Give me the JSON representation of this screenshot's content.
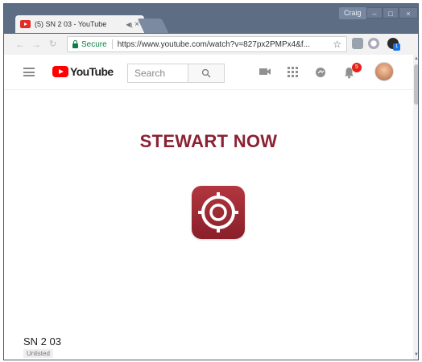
{
  "browser": {
    "tab": {
      "title": "(5) SN 2 03 - YouTube",
      "audio_icon": "speaker-icon",
      "close": "×"
    },
    "profile_name": "Craig",
    "window_controls": {
      "minimize": "–",
      "maximize": "□",
      "close": "×"
    },
    "address": {
      "secure_label": "Secure",
      "url": "https://www.youtube.com/watch?v=827px2PMPx4&f..."
    },
    "extension_badge": "1"
  },
  "youtube": {
    "logo_text": "YouTube",
    "search": {
      "placeholder": "Search"
    },
    "notifications_count": "5"
  },
  "video": {
    "title_card_text": "STEWART NOW",
    "name": "SN 2 03",
    "visibility": "Unlisted"
  },
  "colors": {
    "brand_red": "#ff0000",
    "title_card_red": "#8b2233",
    "secure_green": "#0b8043"
  }
}
